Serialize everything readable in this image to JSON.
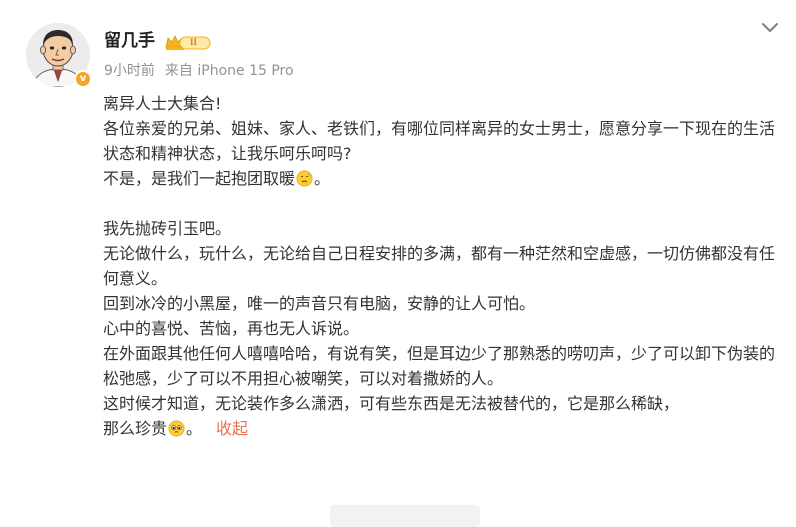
{
  "author": {
    "name": "留几手",
    "level_badge": "II",
    "verified_badge": "v"
  },
  "post_meta": {
    "time": "9小时前",
    "source": "来自 iPhone 15 Pro"
  },
  "post": {
    "p1": "离异人士大集合!",
    "p2": "各位亲爱的兄弟、姐妹、家人、老铁们，有哪位同样离异的女士男士，愿意分享一下现在的生活状态和精神状态，让我乐呵乐呵吗?",
    "p3_text": "不是，是我们一起抱团取暖",
    "p3_end": "。",
    "p4": "我先抛砖引玉吧。",
    "p5": "无论做什么，玩什么，无论给自己日程安排的多满，都有一种茫然和空虚感，一切仿佛都没有任何意义。",
    "p6": "回到冰冷的小黑屋，唯一的声音只有电脑，安静的让人可怕。",
    "p7": "心中的喜悦、苦恼，再也无人诉说。",
    "p8": "在外面跟其他任何人嘻嘻哈哈，有说有笑，但是耳边少了那熟悉的唠叨声，少了可以卸下伪装的松弛感，少了可以不用担心被嘲笑，可以对着撒娇的人。",
    "p9_line1": "这时候才知道，无论装作多么潇洒，可有些东西是无法被替代的，它是那么稀缺，",
    "p9_line2": "那么珍贵",
    "p9_end": "。",
    "collapse_label": "收起"
  },
  "icons": {
    "more": "chevron-down-icon",
    "emoji_sad": "sad-sweat-emoji-icon",
    "emoji_pleading": "pleading-emoji-icon"
  },
  "colors": {
    "link": "#eb7350",
    "meta": "#939393",
    "text": "#333333",
    "badge": "#f5a623"
  }
}
